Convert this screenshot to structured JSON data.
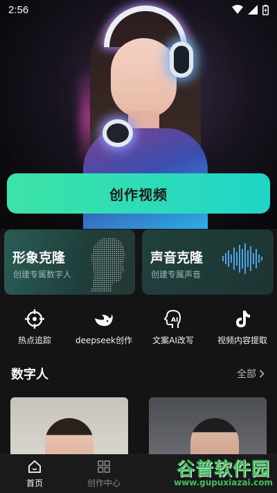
{
  "status_bar": {
    "time": "2:56"
  },
  "hero": {
    "create_label": "创作视频"
  },
  "cards": [
    {
      "title": "形象克隆",
      "subtitle": "创建专属数字人"
    },
    {
      "title": "声音克隆",
      "subtitle": "创建专属声音"
    }
  ],
  "tools": [
    {
      "label": "热点追踪",
      "icon": "crosshair-icon"
    },
    {
      "label": "deepseek创作",
      "icon": "whale-icon"
    },
    {
      "label": "文案AI改写",
      "icon": "ai-head-icon"
    },
    {
      "label": "视频内容提取",
      "icon": "tiktok-icon"
    }
  ],
  "section": {
    "title": "数字人",
    "see_all": "全部"
  },
  "tabbar": [
    {
      "label": "首页",
      "icon": "home-icon",
      "active": true
    },
    {
      "label": "创作中心",
      "icon": "grid-icon",
      "active": false
    }
  ],
  "watermark": {
    "main": "谷普软件园",
    "url": "www.gupuxiazai.com"
  },
  "colors": {
    "accent_start": "#3de3a6",
    "accent_end": "#1fd5c8",
    "background": "#141414"
  }
}
